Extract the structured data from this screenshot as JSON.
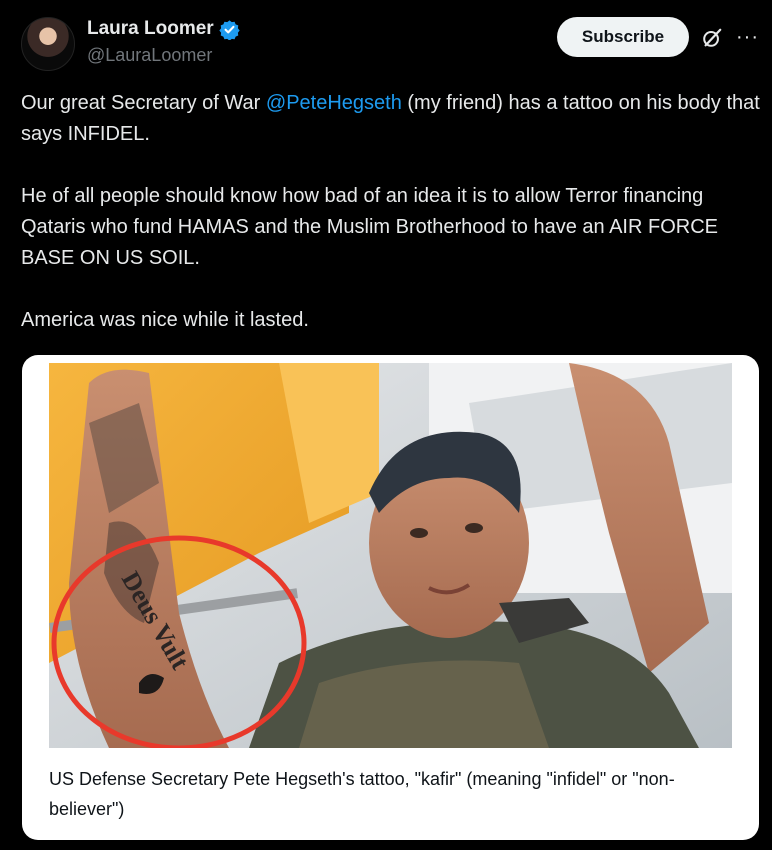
{
  "author": {
    "name": "Laura Loomer",
    "handle": "@LauraLoomer",
    "verified": true,
    "verified_color": "#1d9bf0"
  },
  "actions": {
    "subscribe_label": "Subscribe",
    "grok_icon": "grok-icon",
    "more_icon": "more-icon"
  },
  "tweet": {
    "p1_before": "Our great Secretary of War ",
    "p1_mention": "@PeteHegseth",
    "p1_after": " (my friend) has a tattoo on his body that says INFIDEL.",
    "p2": "He of all people should know how bad of an idea it is to allow Terror financing Qataris who fund HAMAS and the Muslim Brotherhood to have an AIR FORCE BASE ON US SOIL.",
    "p3": "America was nice while it lasted.",
    "mention_color": "#1d9bf0"
  },
  "card": {
    "caption": "US Defense Secretary Pete Hegseth's tattoo, \"kafir\" (meaning \"infidel\" or \"non-believer\")",
    "tattoo_text": "Deus Vult",
    "highlight_color": "#e8392b"
  },
  "theme": {
    "background": "#000000",
    "text": "#e7e9ea",
    "secondary_text": "#71767b"
  }
}
